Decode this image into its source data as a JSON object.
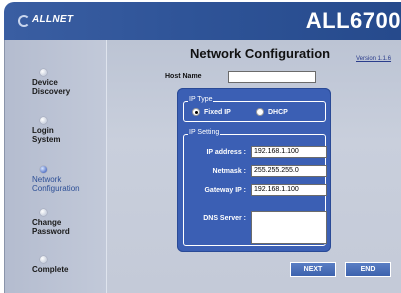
{
  "header": {
    "brand": "ALLNET",
    "product": "ALL6700"
  },
  "steps": [
    {
      "label": "Device\nDiscovery",
      "active": false
    },
    {
      "label": "Login\nSystem",
      "active": false
    },
    {
      "label": "Network\nConfiguration",
      "active": true
    },
    {
      "label": "Change\nPassword",
      "active": false
    },
    {
      "label": "Complete",
      "active": false
    }
  ],
  "page": {
    "title": "Network Configuration",
    "version": "Version 1.1.6"
  },
  "host": {
    "label": "Host Name",
    "value": ""
  },
  "ip_type": {
    "legend": "IP Type",
    "options": [
      {
        "label": "Fixed IP",
        "selected": true
      },
      {
        "label": "DHCP",
        "selected": false
      }
    ]
  },
  "ip_setting": {
    "legend": "IP Setting",
    "ip_label": "IP address :",
    "ip_value": "192.168.1.100",
    "mask_label": "Netmask :",
    "mask_value": "255.255.255.0",
    "gw_label": "Gateway IP :",
    "gw_value": "192.168.1.100",
    "dns_label": "DNS Server :",
    "dns_value": ""
  },
  "buttons": {
    "next": "NEXT",
    "end": "END"
  }
}
